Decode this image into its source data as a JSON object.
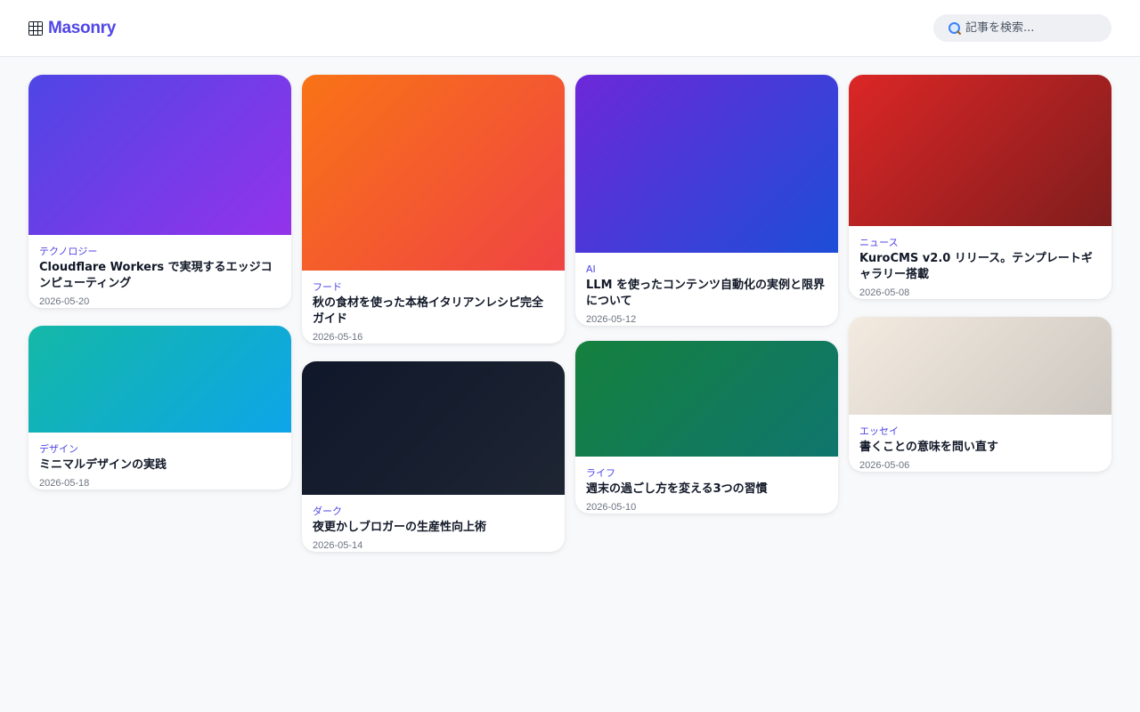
{
  "header": {
    "logo_text": "Masonry",
    "logo_icon": "grid-icon",
    "search_placeholder": "記事を検索...",
    "search_icon": "search-icon"
  },
  "cards": [
    {
      "category": "テクノロジー",
      "title": "Cloudflare Workers で実現するエッジコンピューティング",
      "date": "2026-05-20",
      "gradient": [
        "#4f46e5",
        "#9333ea"
      ]
    },
    {
      "category": "デザイン",
      "title": "ミニマルデザインの実践",
      "date": "2026-05-18",
      "gradient": [
        "#14b8a6",
        "#0ea5e9"
      ]
    },
    {
      "category": "フード",
      "title": "秋の食材を使った本格イタリアンレシピ完全ガイド",
      "date": "2026-05-16",
      "gradient": [
        "#f97316",
        "#ef4444"
      ]
    },
    {
      "category": "ダーク",
      "title": "夜更かしブロガーの生産性向上術",
      "date": "2026-05-14",
      "gradient": [
        "#0f172a",
        "#1e2533"
      ]
    },
    {
      "category": "AI",
      "title": "LLM を使ったコンテンツ自動化の実例と限界について",
      "date": "2026-05-12",
      "gradient": [
        "#6d28d9",
        "#1d4ed8"
      ]
    },
    {
      "category": "ライフ",
      "title": "週末の過ごし方を変える3つの習慣",
      "date": "2026-05-10",
      "gradient": [
        "#15803d",
        "#0f766e"
      ]
    },
    {
      "category": "ニュース",
      "title": "KuroCMS v2.0 リリース。テンプレートギャラリー搭載",
      "date": "2026-05-08",
      "gradient": [
        "#dc2626",
        "#7f1d1d"
      ]
    },
    {
      "category": "エッセイ",
      "title": "書くことの意味を問い直す",
      "date": "2026-05-06",
      "gradient": [
        "#f3ebe0",
        "#ccc7c0"
      ]
    }
  ]
}
